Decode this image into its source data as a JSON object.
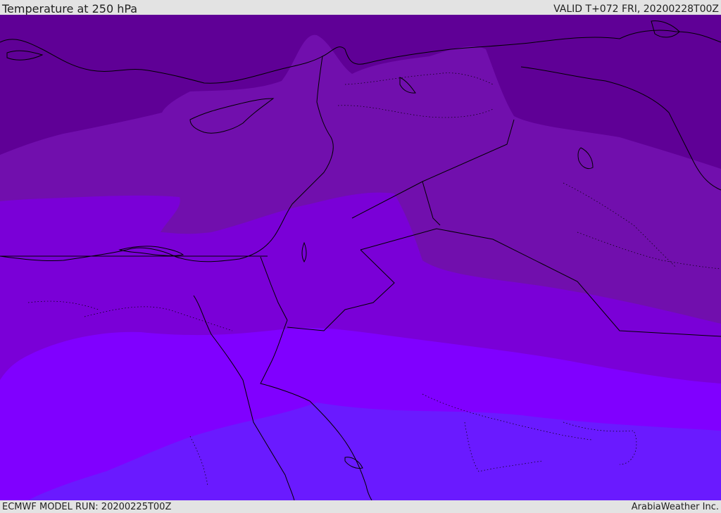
{
  "header": {
    "title": "Temperature at 250 hPa",
    "valid": "VALID T+072 FRI, 20200228T00Z"
  },
  "footer": {
    "model_run": "ECMWF MODEL RUN: 20200225T00Z",
    "credit": "ArabiaWeather Inc."
  },
  "map": {
    "field": "temperature-250hPa",
    "bands": [
      {
        "name": "band-coldest",
        "color": "#5f0096"
      },
      {
        "name": "band-2",
        "color": "#710fad"
      },
      {
        "name": "band-3",
        "color": "#7a00d7"
      },
      {
        "name": "band-4",
        "color": "#8000ff"
      },
      {
        "name": "band-warmest",
        "color": "#6a1aff"
      }
    ],
    "coastline_color": "#000000",
    "border_style": "dotted"
  }
}
